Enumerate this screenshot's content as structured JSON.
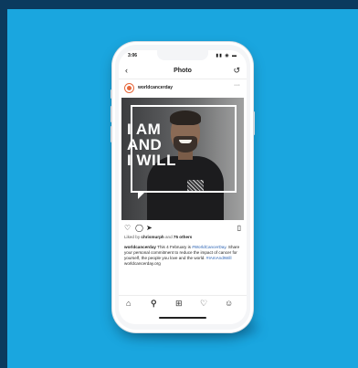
{
  "status": {
    "time": "3:06",
    "indicators": "▮▮ ◉ ▬"
  },
  "nav": {
    "title": "Photo",
    "back_icon": "back-arrow-icon",
    "refresh_icon": "refresh-icon"
  },
  "post": {
    "username": "worldcancerday",
    "more_icon": "more-icon",
    "image_text": [
      "I AM",
      "AND",
      "I WILL"
    ]
  },
  "actions": {
    "icons": [
      "heart-icon",
      "comment-icon",
      "share-icon",
      "bookmark-icon"
    ]
  },
  "likes": {
    "prefix": "Liked by",
    "user": "chrismurph",
    "middle": "and",
    "count": "75 others"
  },
  "caption": {
    "user": "worldcancerday",
    "text1": " This 4 February is ",
    "tag1": "#WorldCancerDay",
    "text2": ". Share your personal commitment to reduce the impact of cancer for yourself, the people you love and the world. ",
    "tag2": "#IAmAndIWill",
    "text3": " worldcancerday.org"
  },
  "tabbar": {
    "icons": [
      "home-icon",
      "search-icon",
      "add-post-icon",
      "activity-heart-icon",
      "profile-icon"
    ]
  },
  "colors": {
    "background": "#1aa6df",
    "outer": "#0b3a5e",
    "hashtag": "#2a62b3"
  }
}
